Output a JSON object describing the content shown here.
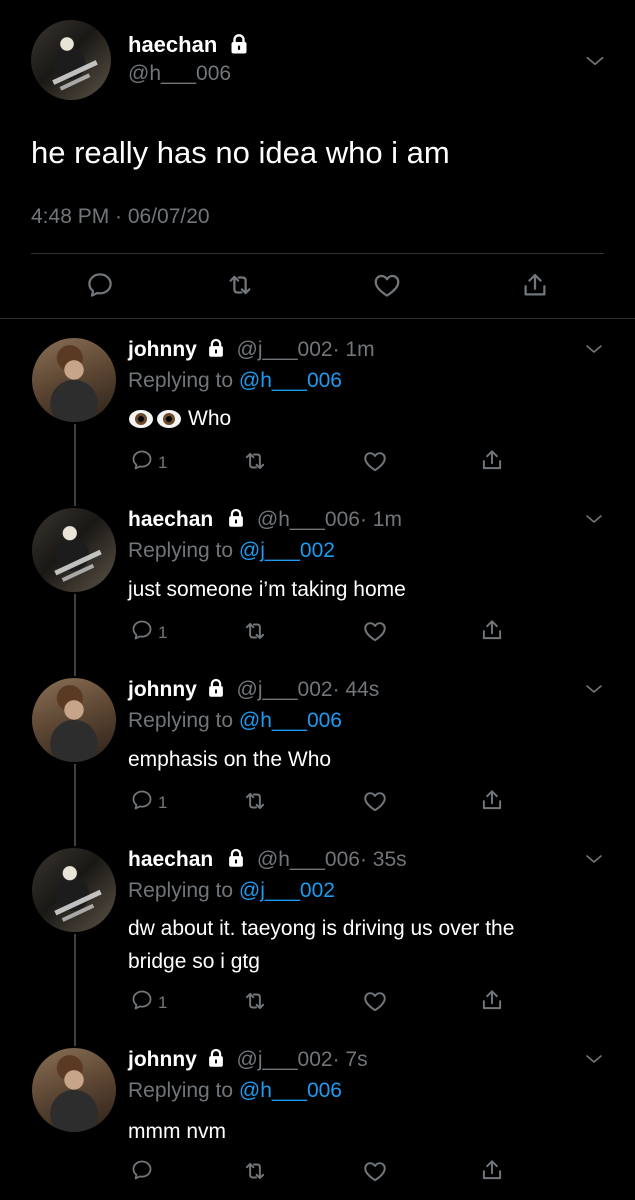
{
  "main_tweet": {
    "name": "haechan",
    "handle": "@h___006",
    "text": "he really has no idea who i am",
    "timestamp": "4:48 PM · 06/07/20"
  },
  "replies": [
    {
      "name": "johnny",
      "handle": "@j___002",
      "time": "· 1m",
      "replying_label": "Replying to",
      "replying_to": "@h___006",
      "text": "Who",
      "reply_count": "1"
    },
    {
      "name": "haechan",
      "handle": "@h___006",
      "time": "· 1m",
      "replying_label": "Replying to",
      "replying_to": "@j___002",
      "text": "just someone i’m taking home",
      "reply_count": "1"
    },
    {
      "name": "johnny",
      "handle": "@j___002",
      "time": "· 44s",
      "replying_label": "Replying to",
      "replying_to": "@h___006",
      "text": "emphasis on the Who",
      "reply_count": "1"
    },
    {
      "name": "haechan",
      "handle": "@h___006",
      "time": "· 35s",
      "replying_label": "Replying to",
      "replying_to": "@j___002",
      "text_line1": "dw about it. taeyong is driving us over the",
      "text_line2": "bridge so i gtg",
      "reply_count": "1"
    },
    {
      "name": "johnny",
      "handle": "@j___002",
      "time": "· 7s",
      "replying_label": "Replying to",
      "replying_to": "@h___006",
      "text": "mmm nvm",
      "reply_count": ""
    }
  ],
  "icons": {
    "reply": "reply-icon",
    "retweet": "retweet-icon",
    "like": "heart-icon",
    "share": "share-icon",
    "lock": "lock-icon",
    "more": "chevron-down-icon",
    "eyes": "eyes-emoji"
  },
  "colors": {
    "background": "#000000",
    "link": "#1d9bf0",
    "secondary_text": "#71767b",
    "divider": "#2f3336"
  }
}
